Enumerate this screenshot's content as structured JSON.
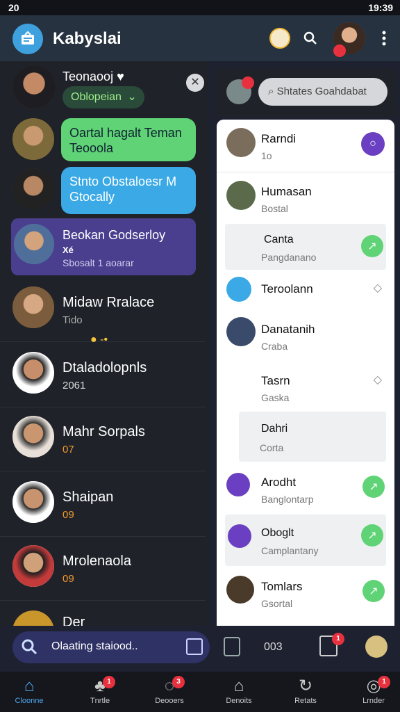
{
  "status": {
    "time_left": "20",
    "time_right": "19:39"
  },
  "app": {
    "title": "Kabyslai"
  },
  "left": {
    "pinned": {
      "name": "Teonaooj",
      "heart": "♥",
      "dropdown_label": "Oblopeian"
    },
    "bubble1": {
      "line1": "Oartal hagalt Teman",
      "line2": "Teooola"
    },
    "bubble2": {
      "line1": "Stnto Obstaloesr M",
      "line2": "Gtocally"
    },
    "bubble3": {
      "line1": "Beokan Godserloy",
      "line2": "Xé",
      "line3": "Sbosalt 1 aoarar"
    },
    "chats": [
      {
        "name": "Midaw Rralace",
        "sub": "Tido"
      },
      {
        "name": "Dtaladolopnls",
        "sub": "2061"
      },
      {
        "name": "Mahr Sorpals",
        "sub": "07"
      },
      {
        "name": "Shaipan",
        "sub": "09"
      },
      {
        "name": "Mrolenaola",
        "sub": "09"
      },
      {
        "name": "Der",
        "sub": ""
      }
    ]
  },
  "right": {
    "search_placeholder": "Shtates Goahdabat",
    "items": [
      {
        "name": "Rarndi",
        "sub": "1o"
      },
      {
        "name": "Humasan",
        "sub": "Bostal"
      },
      {
        "name": "Canta",
        "sub": "Pangdanano"
      },
      {
        "name": "Teroolann",
        "sub": ""
      },
      {
        "name": "Danatanih",
        "sub": "Craba"
      },
      {
        "name": "Tasrn",
        "sub": "Gaska"
      },
      {
        "name": "Dahri",
        "sub": "Corta"
      },
      {
        "name": "Arodht",
        "sub": "Banglontarp"
      },
      {
        "name": "Oboglt",
        "sub": "Camplantany"
      },
      {
        "name": "Tomlars",
        "sub": "Gsortal"
      }
    ]
  },
  "bottom": {
    "search_text": "Olaating staiood..",
    "counter": "003",
    "nav": [
      {
        "label": "Cloonne",
        "badge": ""
      },
      {
        "label": "Tnrtle",
        "badge": "1"
      },
      {
        "label": "Deooers",
        "badge": "3"
      },
      {
        "label": "Denoits",
        "badge": ""
      },
      {
        "label": "Retats",
        "badge": "1"
      },
      {
        "label": "Lrnder",
        "badge": "1"
      }
    ],
    "top_badge": "1"
  },
  "colors": {
    "accent": "#3ea1de",
    "green": "#5fd375",
    "purple": "#6a3fc2",
    "bubble_green": "#5fd375",
    "bubble_blue": "#3aa9e6",
    "bubble_purple": "#4a3f8f"
  }
}
